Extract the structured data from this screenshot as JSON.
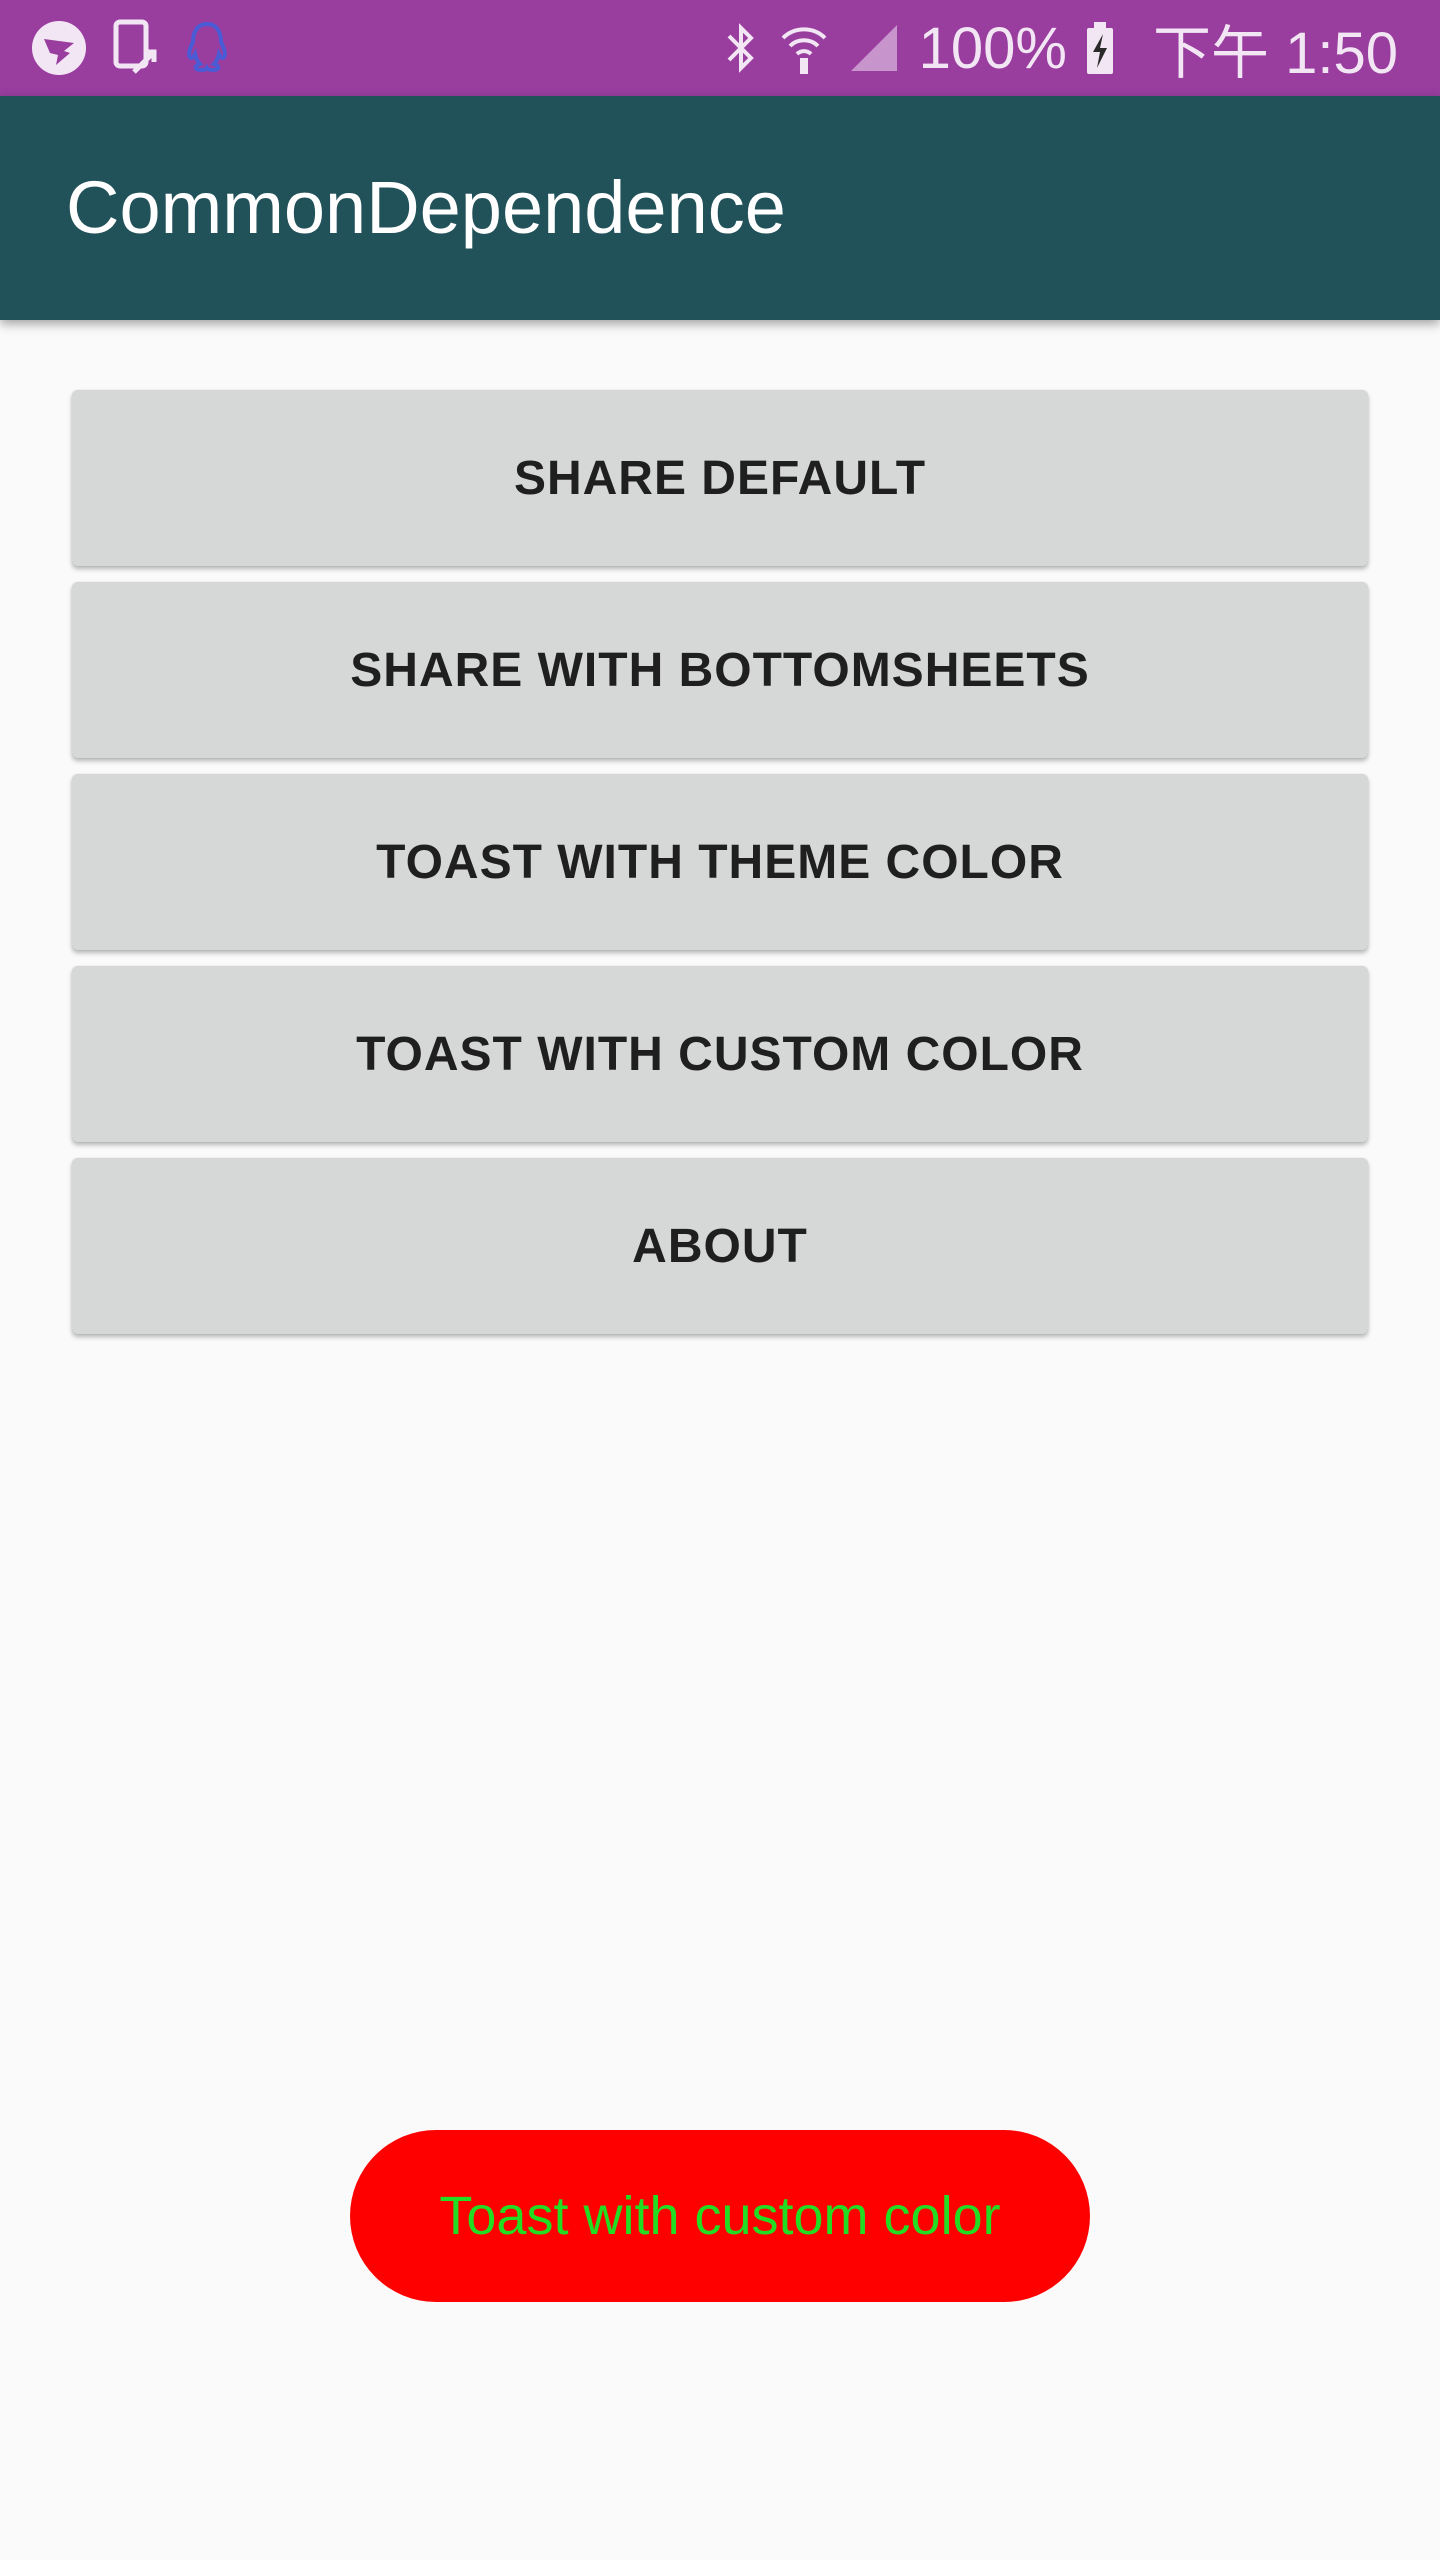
{
  "status_bar": {
    "icons_left": [
      "dingtalk-icon",
      "screen-share-icon",
      "qq-icon"
    ],
    "icons_right": [
      "bluetooth-icon",
      "wifi-icon",
      "signal-icon"
    ],
    "battery_percent": "100%",
    "battery_icon": "battery-charging-icon",
    "time": "下午 1:50",
    "color": "#993e9f"
  },
  "app_bar": {
    "title": "CommonDependence",
    "color": "#225259"
  },
  "buttons": [
    {
      "label": "SHARE DEFAULT"
    },
    {
      "label": "SHARE WITH BOTTOMSHEETS"
    },
    {
      "label": "TOAST WITH THEME COLOR"
    },
    {
      "label": "TOAST WITH CUSTOM COLOR"
    },
    {
      "label": "ABOUT"
    }
  ],
  "toast": {
    "text": "Toast with custom color",
    "background": "#ff0000",
    "text_color": "#22dd22"
  }
}
